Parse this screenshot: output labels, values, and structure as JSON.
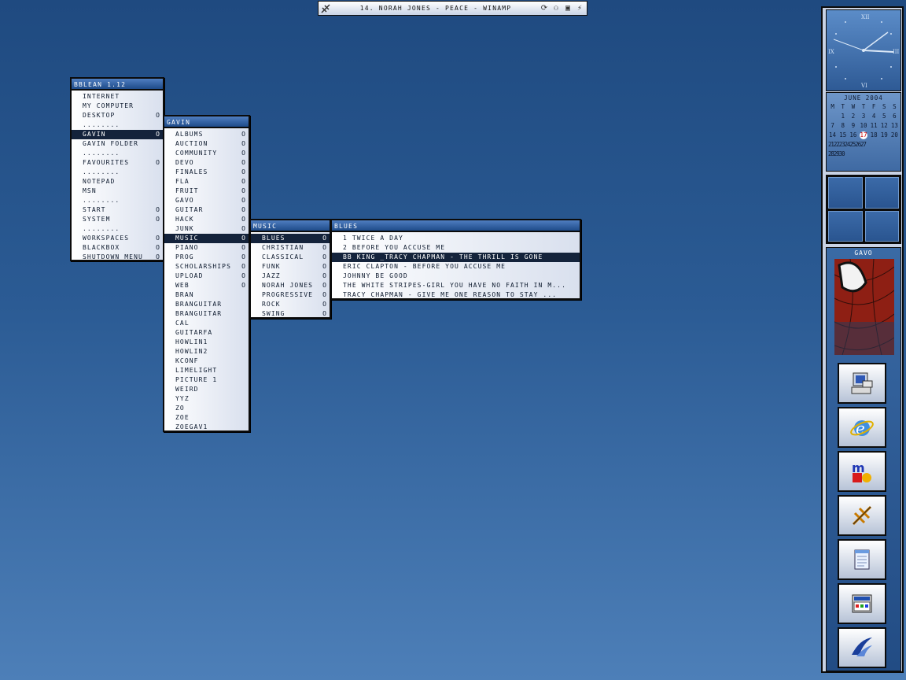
{
  "topbar": {
    "title": "14. NORAH JONES - PEACE - WINAMP"
  },
  "menu_bblean": {
    "title": "BBLEAN 1.12",
    "items": [
      {
        "label": "INTERNET",
        "arrow": ""
      },
      {
        "label": "MY COMPUTER",
        "arrow": ""
      },
      {
        "label": "DESKTOP",
        "arrow": "O"
      },
      {
        "label": "........",
        "arrow": ""
      },
      {
        "label": "GAVIN",
        "arrow": "O"
      },
      {
        "label": "GAVIN FOLDER",
        "arrow": ""
      },
      {
        "label": "........",
        "arrow": ""
      },
      {
        "label": "FAVOURITES",
        "arrow": "O"
      },
      {
        "label": "........",
        "arrow": ""
      },
      {
        "label": "NOTEPAD",
        "arrow": ""
      },
      {
        "label": "MSN",
        "arrow": ""
      },
      {
        "label": "........",
        "arrow": ""
      },
      {
        "label": "START",
        "arrow": "O"
      },
      {
        "label": "SYSTEM",
        "arrow": "O"
      },
      {
        "label": "........",
        "arrow": ""
      },
      {
        "label": "WORKSPACES",
        "arrow": "O"
      },
      {
        "label": "BLACKBOX",
        "arrow": "O"
      },
      {
        "label": "SHUTDOWN MENU",
        "arrow": "O"
      }
    ]
  },
  "menu_gavin": {
    "title": "GAVIN",
    "items": [
      {
        "label": "ALBUMS",
        "arrow": "O"
      },
      {
        "label": "AUCTION",
        "arrow": "O"
      },
      {
        "label": "COMMUNITY",
        "arrow": "O"
      },
      {
        "label": "DEVO",
        "arrow": "O"
      },
      {
        "label": "FINALES",
        "arrow": "O"
      },
      {
        "label": "FLA",
        "arrow": "O"
      },
      {
        "label": "FRUIT",
        "arrow": "O"
      },
      {
        "label": "GAVO",
        "arrow": "O"
      },
      {
        "label": "GUITAR",
        "arrow": "O"
      },
      {
        "label": "HACK",
        "arrow": "O"
      },
      {
        "label": "JUNK",
        "arrow": "O"
      },
      {
        "label": "MUSIC",
        "arrow": "O"
      },
      {
        "label": "PIANO",
        "arrow": "O"
      },
      {
        "label": "PROG",
        "arrow": "O"
      },
      {
        "label": "SCHOLARSHIPS",
        "arrow": "O"
      },
      {
        "label": "UPLOAD",
        "arrow": "O"
      },
      {
        "label": "WEB",
        "arrow": "O"
      },
      {
        "label": "BRAN",
        "arrow": ""
      },
      {
        "label": "BRANGUITAR",
        "arrow": ""
      },
      {
        "label": "BRANGUITAR",
        "arrow": ""
      },
      {
        "label": "CAL",
        "arrow": ""
      },
      {
        "label": "GUITARFA",
        "arrow": ""
      },
      {
        "label": "HOWLIN1",
        "arrow": ""
      },
      {
        "label": "HOWLIN2",
        "arrow": ""
      },
      {
        "label": "KCONF",
        "arrow": ""
      },
      {
        "label": "LIMELIGHT",
        "arrow": ""
      },
      {
        "label": "PICTURE 1",
        "arrow": ""
      },
      {
        "label": "WEIRD",
        "arrow": ""
      },
      {
        "label": "YYZ",
        "arrow": ""
      },
      {
        "label": "ZO",
        "arrow": ""
      },
      {
        "label": "ZOE",
        "arrow": ""
      },
      {
        "label": "ZOEGAV1",
        "arrow": ""
      }
    ]
  },
  "menu_music": {
    "title": "MUSIC",
    "items": [
      {
        "label": "BLUES",
        "arrow": "O"
      },
      {
        "label": "CHRISTIAN",
        "arrow": "O"
      },
      {
        "label": "CLASSICAL",
        "arrow": "O"
      },
      {
        "label": "FUNK",
        "arrow": "O"
      },
      {
        "label": "JAZZ",
        "arrow": "O"
      },
      {
        "label": "NORAH JONES",
        "arrow": "O"
      },
      {
        "label": "PROGRESSIVE",
        "arrow": "O"
      },
      {
        "label": "ROCK",
        "arrow": "O"
      },
      {
        "label": "SWING",
        "arrow": "O"
      }
    ]
  },
  "menu_blues": {
    "title": "BLUES",
    "items": [
      {
        "label": "1 TWICE A DAY"
      },
      {
        "label": "2 BEFORE YOU ACCUSE ME"
      },
      {
        "label": "BB KING _TRACY CHAPMAN - THE THRILL IS GONE"
      },
      {
        "label": "ERIC CLAPTON - BEFORE YOU ACCUSE ME"
      },
      {
        "label": "JOHNNY BE GOOD"
      },
      {
        "label": "THE WHITE STRIPES-GIRL YOU HAVE NO FAITH IN M..."
      },
      {
        "label": "TRACY CHAPMAN - GIVE ME ONE REASON TO STAY ..."
      }
    ]
  },
  "clock": {
    "xii": "XII",
    "iii": "III",
    "vi": "VI",
    "ix": "IX"
  },
  "calendar": {
    "month": "JUNE 2004",
    "weekdays": [
      "M",
      "T",
      "W",
      "T",
      "F",
      "S",
      "S"
    ],
    "row1": [
      "",
      "1",
      "2",
      "3",
      "4",
      "5",
      "6"
    ],
    "row2": [
      "7",
      "8",
      "9",
      "10",
      "11",
      "12",
      "13"
    ],
    "row3": [
      "14",
      "15",
      "16",
      "17",
      "18",
      "19",
      "20"
    ],
    "row4": "21222324252627",
    "row5": "282930",
    "today": "17"
  },
  "tray": {
    "avatar_label": "GAVO"
  },
  "colors": {
    "selected": "#14233b",
    "title_bar": "#1e4b8a",
    "desktop": "#2b5b94"
  }
}
